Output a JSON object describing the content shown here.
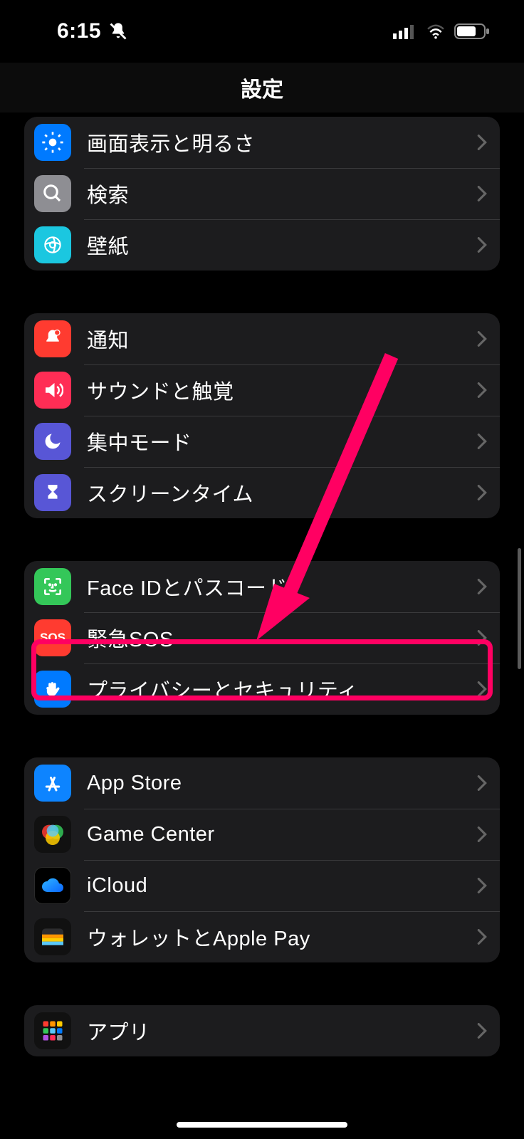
{
  "status": {
    "time": "6:15"
  },
  "nav": {
    "title": "設定"
  },
  "groups": [
    {
      "id": "display-group",
      "rows": [
        {
          "label": "画面表示と明るさ",
          "name": "display-brightness",
          "icon": "brightness-icon",
          "bg": "bg-blue"
        },
        {
          "label": "検索",
          "name": "search",
          "icon": "search-icon",
          "bg": "bg-gray"
        },
        {
          "label": "壁紙",
          "name": "wallpaper",
          "icon": "wallpaper-icon",
          "bg": "bg-cyan"
        }
      ]
    },
    {
      "id": "notifications-group",
      "rows": [
        {
          "label": "通知",
          "name": "notifications",
          "icon": "bell-icon",
          "bg": "bg-red"
        },
        {
          "label": "サウンドと触覚",
          "name": "sounds-haptics",
          "icon": "speaker-icon",
          "bg": "bg-pink"
        },
        {
          "label": "集中モード",
          "name": "focus",
          "icon": "moon-icon",
          "bg": "bg-indigo"
        },
        {
          "label": "スクリーンタイム",
          "name": "screen-time",
          "icon": "hourglass-icon",
          "bg": "bg-indigo"
        }
      ]
    },
    {
      "id": "security-group",
      "rows": [
        {
          "label": "Face IDとパスコード",
          "name": "face-id-passcode",
          "icon": "faceid-icon",
          "bg": "bg-green"
        },
        {
          "label": "緊急SOS",
          "name": "emergency-sos",
          "icon": "sos-icon",
          "bg": "bg-sos",
          "text_icon": "SOS"
        },
        {
          "label": "プライバシーとセキュリティ",
          "name": "privacy-security",
          "icon": "hand-icon",
          "bg": "bg-blue",
          "highlighted": true
        }
      ]
    },
    {
      "id": "store-group",
      "rows": [
        {
          "label": "App Store",
          "name": "app-store",
          "icon": "appstore-icon",
          "bg": "bg-appstore"
        },
        {
          "label": "Game Center",
          "name": "game-center",
          "icon": "gamecenter-icon",
          "bg": "bg-gradient"
        },
        {
          "label": "iCloud",
          "name": "icloud",
          "icon": "icloud-icon",
          "bg": "bg-black"
        },
        {
          "label": "ウォレットとApple Pay",
          "name": "wallet-apple-pay",
          "icon": "wallet-icon",
          "bg": "bg-wallet"
        }
      ]
    },
    {
      "id": "apps-group",
      "rows": [
        {
          "label": "アプリ",
          "name": "apps",
          "icon": "apps-grid-icon",
          "bg": "bg-apps"
        }
      ]
    }
  ],
  "annotation": {
    "arrow_color": "#ff0062"
  }
}
